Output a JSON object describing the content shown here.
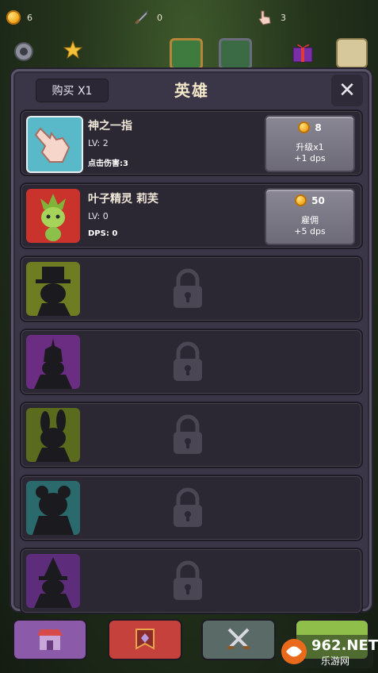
{
  "hud": {
    "gold": "6",
    "swords": "0",
    "taps": "3"
  },
  "panel": {
    "buy_label": "购买 X1",
    "title": "英雄",
    "close_label": "✕"
  },
  "heroes": [
    {
      "name": "神之一指",
      "level": "LV: 2",
      "stat": "点击伤害:3",
      "cost": "8",
      "action": "升级x1",
      "dps_gain": "+1 dps",
      "portrait": "tap-finger-icon"
    },
    {
      "name": "叶子精灵 莉芙",
      "level": "LV: 0",
      "stat": "DPS: 0",
      "cost": "50",
      "action": "雇佣",
      "dps_gain": "+5 dps",
      "portrait": "leaf-sprite-portrait"
    }
  ],
  "locked_heroes": [
    {
      "portrait": "locked-silhouette-top-hat",
      "tint": "#6e7d22"
    },
    {
      "portrait": "locked-silhouette-knight",
      "tint": "#6a2d82"
    },
    {
      "portrait": "locked-silhouette-bunny",
      "tint": "#5b6b1e"
    },
    {
      "portrait": "locked-silhouette-bear",
      "tint": "#2a6a6c"
    },
    {
      "portrait": "locked-silhouette-wizard",
      "tint": "#5d2c7a"
    }
  ],
  "watermark": {
    "brand": "962.NET",
    "sub": "乐游网"
  },
  "colors": {
    "panel_bg": "#3a3547",
    "card_bg": "#2b2834",
    "button_gray": "#7d7a87",
    "coin_gold": "#f0a51c",
    "title_text": "#f3e7c9"
  }
}
